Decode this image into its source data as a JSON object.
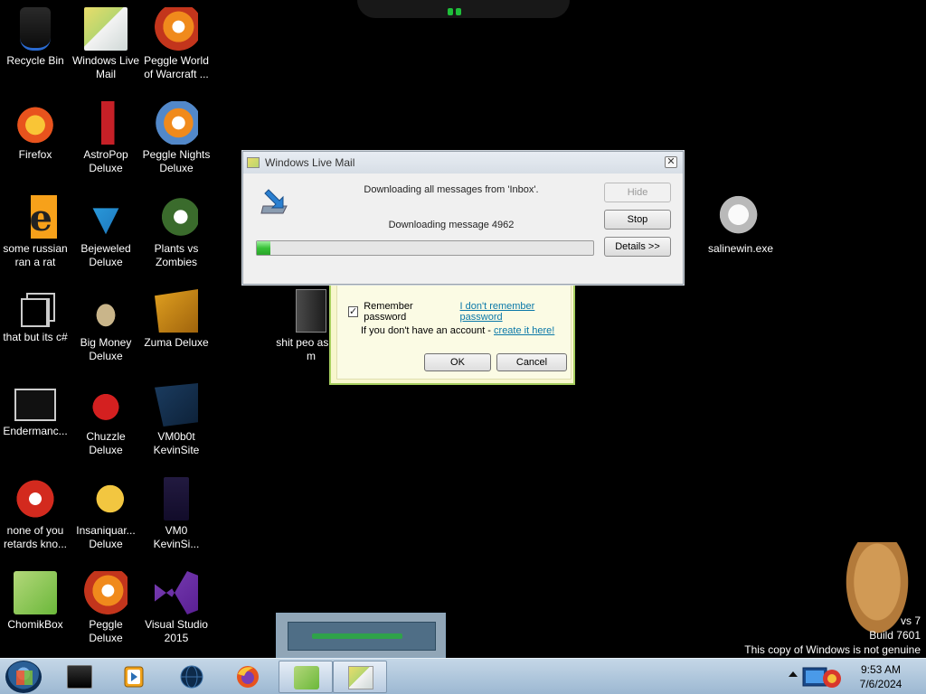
{
  "desktop_icons": [
    {
      "label": "Recycle Bin",
      "icon": "recycle-bin-icon"
    },
    {
      "label": "Windows Live Mail",
      "icon": "windows-live-mail-icon"
    },
    {
      "label": "Peggle World of Warcraft ...",
      "icon": "peggle-icon"
    },
    {
      "label": "Firefox",
      "icon": "firefox-icon"
    },
    {
      "label": "AstroPop Deluxe",
      "icon": "astropop-icon"
    },
    {
      "label": "Peggle Nights Deluxe",
      "icon": "peggle-nights-icon"
    },
    {
      "label": "some russian ran a rat",
      "icon": "shortcut-icon"
    },
    {
      "label": "Bejeweled Deluxe",
      "icon": "bejeweled-icon"
    },
    {
      "label": "Plants vs Zombies",
      "icon": "plants-vs-zombies-icon"
    },
    {
      "label": "that but its c#",
      "icon": "folders-icon"
    },
    {
      "label": "Big Money Deluxe",
      "icon": "big-money-icon"
    },
    {
      "label": "Zuma Deluxe",
      "icon": "zuma-icon"
    },
    {
      "label": "Endermanc...",
      "icon": "window-icon"
    },
    {
      "label": "Chuzzle Deluxe",
      "icon": "chuzzle-icon"
    },
    {
      "label": "VM0b0t KevinSite",
      "icon": "vm-folder-icon"
    },
    {
      "label": "none of you retards kno...",
      "icon": "game-icon"
    },
    {
      "label": "Insaniquar... Deluxe",
      "icon": "insaniquarium-icon"
    },
    {
      "label": "VM0 KevinSi...",
      "icon": "file-icon"
    },
    {
      "label": "ChomikBox",
      "icon": "chomikbox-icon"
    },
    {
      "label": "Peggle Deluxe",
      "icon": "peggle-deluxe-icon"
    },
    {
      "label": "Visual Studio 2015",
      "icon": "visual-studio-icon"
    },
    {
      "label": "shit peo asked m",
      "icon": "folder-icon"
    },
    {
      "label": "salinewin.exe",
      "icon": "executable-icon"
    }
  ],
  "download_dialog": {
    "title": "Windows Live Mail",
    "message_1": "Downloading all messages from 'Inbox'.",
    "message_2": "Downloading message 4962",
    "progress": 0.04,
    "hide_label": "Hide",
    "stop_label": "Stop",
    "details_label": "Details >>",
    "close_glyph": "✕"
  },
  "login_dialog": {
    "remember_label": "Remember password",
    "remember_checked": true,
    "forgot_link": "I don't remember password",
    "account_text": "If you don't have an account - ",
    "create_link": "create it here!",
    "ok_label": "OK",
    "cancel_label": "Cancel"
  },
  "watermark": {
    "line1": "vs 7",
    "line2": "Build 7601",
    "line3": "This copy of Windows is not genuine"
  },
  "taskbar": {
    "items": [
      {
        "name": "taskbar-item-cmd",
        "icon": "terminal-icon"
      },
      {
        "name": "taskbar-item-media-player",
        "icon": "media-player-icon"
      },
      {
        "name": "taskbar-item-browser",
        "icon": "globe-icon"
      },
      {
        "name": "taskbar-item-firefox",
        "icon": "firefox-icon"
      },
      {
        "name": "taskbar-item-chomikbox",
        "icon": "chomikbox-icon"
      },
      {
        "name": "taskbar-item-windows-live-mail",
        "icon": "mail-icon"
      }
    ],
    "clock_time": "9:53 AM",
    "clock_date": "7/6/2024"
  },
  "colors": {
    "progress_green": "#38c238",
    "link_blue": "#0a78a8",
    "taskbar": "#9cb8d2"
  }
}
